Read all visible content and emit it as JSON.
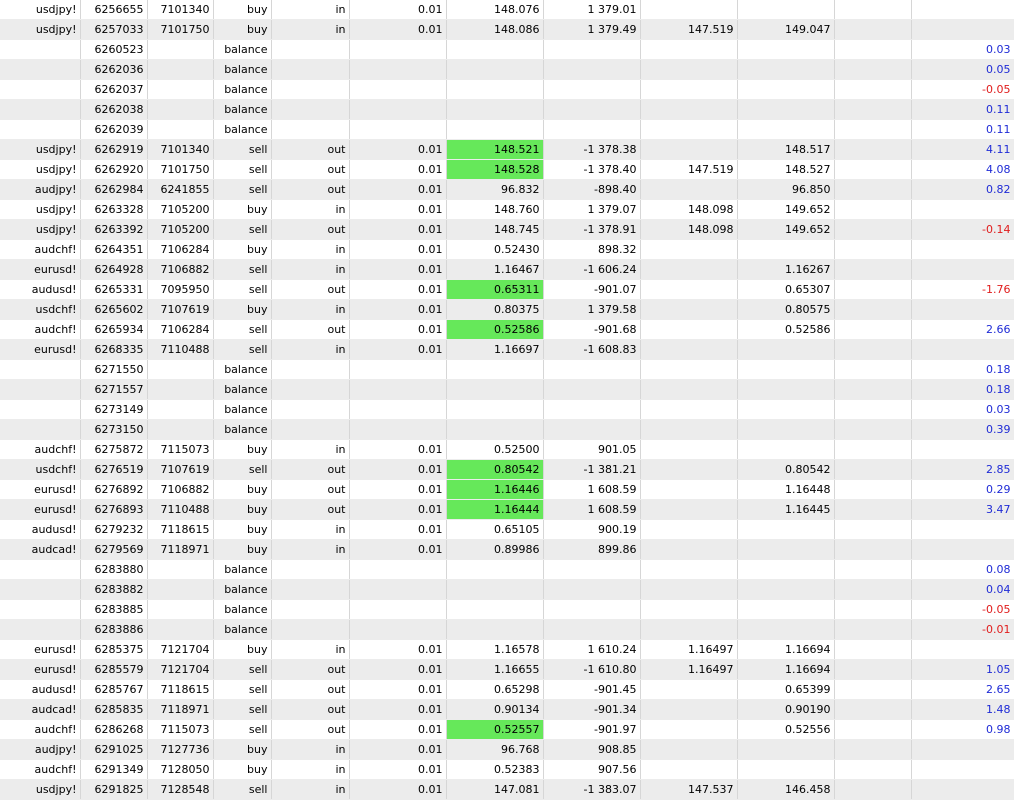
{
  "colors": {
    "highlight": "#66e85a",
    "profit_positive": "#1f2bd6",
    "profit_negative": "#e01c1c",
    "alt_row": "#ececec"
  },
  "rows": [
    {
      "symbol": "usdjpy!",
      "deal": "6256655",
      "order": "7101340",
      "type": "buy",
      "dir": "in",
      "volume": "0.01",
      "price": "148.076",
      "amount": "1 379.01",
      "sl": "",
      "tp": "",
      "profit": "",
      "hl": false
    },
    {
      "symbol": "usdjpy!",
      "deal": "6257033",
      "order": "7101750",
      "type": "buy",
      "dir": "in",
      "volume": "0.01",
      "price": "148.086",
      "amount": "1 379.49",
      "sl": "147.519",
      "tp": "149.047",
      "profit": "",
      "hl": false
    },
    {
      "symbol": "",
      "deal": "6260523",
      "order": "",
      "type": "balance",
      "dir": "",
      "volume": "",
      "price": "",
      "amount": "",
      "sl": "",
      "tp": "",
      "profit": "0.03",
      "hl": false
    },
    {
      "symbol": "",
      "deal": "6262036",
      "order": "",
      "type": "balance",
      "dir": "",
      "volume": "",
      "price": "",
      "amount": "",
      "sl": "",
      "tp": "",
      "profit": "0.05",
      "hl": false
    },
    {
      "symbol": "",
      "deal": "6262037",
      "order": "",
      "type": "balance",
      "dir": "",
      "volume": "",
      "price": "",
      "amount": "",
      "sl": "",
      "tp": "",
      "profit": "-0.05",
      "hl": false
    },
    {
      "symbol": "",
      "deal": "6262038",
      "order": "",
      "type": "balance",
      "dir": "",
      "volume": "",
      "price": "",
      "amount": "",
      "sl": "",
      "tp": "",
      "profit": "0.11",
      "hl": false
    },
    {
      "symbol": "",
      "deal": "6262039",
      "order": "",
      "type": "balance",
      "dir": "",
      "volume": "",
      "price": "",
      "amount": "",
      "sl": "",
      "tp": "",
      "profit": "0.11",
      "hl": false
    },
    {
      "symbol": "usdjpy!",
      "deal": "6262919",
      "order": "7101340",
      "type": "sell",
      "dir": "out",
      "volume": "0.01",
      "price": "148.521",
      "amount": "-1 378.38",
      "sl": "",
      "tp": "148.517",
      "profit": "4.11",
      "hl": true
    },
    {
      "symbol": "usdjpy!",
      "deal": "6262920",
      "order": "7101750",
      "type": "sell",
      "dir": "out",
      "volume": "0.01",
      "price": "148.528",
      "amount": "-1 378.40",
      "sl": "147.519",
      "tp": "148.527",
      "profit": "4.08",
      "hl": true
    },
    {
      "symbol": "audjpy!",
      "deal": "6262984",
      "order": "6241855",
      "type": "sell",
      "dir": "out",
      "volume": "0.01",
      "price": "96.832",
      "amount": "-898.40",
      "sl": "",
      "tp": "96.850",
      "profit": "0.82",
      "hl": false
    },
    {
      "symbol": "usdjpy!",
      "deal": "6263328",
      "order": "7105200",
      "type": "buy",
      "dir": "in",
      "volume": "0.01",
      "price": "148.760",
      "amount": "1 379.07",
      "sl": "148.098",
      "tp": "149.652",
      "profit": "",
      "hl": false
    },
    {
      "symbol": "usdjpy!",
      "deal": "6263392",
      "order": "7105200",
      "type": "sell",
      "dir": "out",
      "volume": "0.01",
      "price": "148.745",
      "amount": "-1 378.91",
      "sl": "148.098",
      "tp": "149.652",
      "profit": "-0.14",
      "hl": false
    },
    {
      "symbol": "audchf!",
      "deal": "6264351",
      "order": "7106284",
      "type": "buy",
      "dir": "in",
      "volume": "0.01",
      "price": "0.52430",
      "amount": "898.32",
      "sl": "",
      "tp": "",
      "profit": "",
      "hl": false
    },
    {
      "symbol": "eurusd!",
      "deal": "6264928",
      "order": "7106882",
      "type": "sell",
      "dir": "in",
      "volume": "0.01",
      "price": "1.16467",
      "amount": "-1 606.24",
      "sl": "",
      "tp": "1.16267",
      "profit": "",
      "hl": false
    },
    {
      "symbol": "audusd!",
      "deal": "6265331",
      "order": "7095950",
      "type": "sell",
      "dir": "out",
      "volume": "0.01",
      "price": "0.65311",
      "amount": "-901.07",
      "sl": "",
      "tp": "0.65307",
      "profit": "-1.76",
      "hl": true
    },
    {
      "symbol": "usdchf!",
      "deal": "6265602",
      "order": "7107619",
      "type": "buy",
      "dir": "in",
      "volume": "0.01",
      "price": "0.80375",
      "amount": "1 379.58",
      "sl": "",
      "tp": "0.80575",
      "profit": "",
      "hl": false
    },
    {
      "symbol": "audchf!",
      "deal": "6265934",
      "order": "7106284",
      "type": "sell",
      "dir": "out",
      "volume": "0.01",
      "price": "0.52586",
      "amount": "-901.68",
      "sl": "",
      "tp": "0.52586",
      "profit": "2.66",
      "hl": true
    },
    {
      "symbol": "eurusd!",
      "deal": "6268335",
      "order": "7110488",
      "type": "sell",
      "dir": "in",
      "volume": "0.01",
      "price": "1.16697",
      "amount": "-1 608.83",
      "sl": "",
      "tp": "",
      "profit": "",
      "hl": false
    },
    {
      "symbol": "",
      "deal": "6271550",
      "order": "",
      "type": "balance",
      "dir": "",
      "volume": "",
      "price": "",
      "amount": "",
      "sl": "",
      "tp": "",
      "profit": "0.18",
      "hl": false
    },
    {
      "symbol": "",
      "deal": "6271557",
      "order": "",
      "type": "balance",
      "dir": "",
      "volume": "",
      "price": "",
      "amount": "",
      "sl": "",
      "tp": "",
      "profit": "0.18",
      "hl": false
    },
    {
      "symbol": "",
      "deal": "6273149",
      "order": "",
      "type": "balance",
      "dir": "",
      "volume": "",
      "price": "",
      "amount": "",
      "sl": "",
      "tp": "",
      "profit": "0.03",
      "hl": false
    },
    {
      "symbol": "",
      "deal": "6273150",
      "order": "",
      "type": "balance",
      "dir": "",
      "volume": "",
      "price": "",
      "amount": "",
      "sl": "",
      "tp": "",
      "profit": "0.39",
      "hl": false
    },
    {
      "symbol": "audchf!",
      "deal": "6275872",
      "order": "7115073",
      "type": "buy",
      "dir": "in",
      "volume": "0.01",
      "price": "0.52500",
      "amount": "901.05",
      "sl": "",
      "tp": "",
      "profit": "",
      "hl": false
    },
    {
      "symbol": "usdchf!",
      "deal": "6276519",
      "order": "7107619",
      "type": "sell",
      "dir": "out",
      "volume": "0.01",
      "price": "0.80542",
      "amount": "-1 381.21",
      "sl": "",
      "tp": "0.80542",
      "profit": "2.85",
      "hl": true
    },
    {
      "symbol": "eurusd!",
      "deal": "6276892",
      "order": "7106882",
      "type": "buy",
      "dir": "out",
      "volume": "0.01",
      "price": "1.16446",
      "amount": "1 608.59",
      "sl": "",
      "tp": "1.16448",
      "profit": "0.29",
      "hl": true
    },
    {
      "symbol": "eurusd!",
      "deal": "6276893",
      "order": "7110488",
      "type": "buy",
      "dir": "out",
      "volume": "0.01",
      "price": "1.16444",
      "amount": "1 608.59",
      "sl": "",
      "tp": "1.16445",
      "profit": "3.47",
      "hl": true
    },
    {
      "symbol": "audusd!",
      "deal": "6279232",
      "order": "7118615",
      "type": "buy",
      "dir": "in",
      "volume": "0.01",
      "price": "0.65105",
      "amount": "900.19",
      "sl": "",
      "tp": "",
      "profit": "",
      "hl": false
    },
    {
      "symbol": "audcad!",
      "deal": "6279569",
      "order": "7118971",
      "type": "buy",
      "dir": "in",
      "volume": "0.01",
      "price": "0.89986",
      "amount": "899.86",
      "sl": "",
      "tp": "",
      "profit": "",
      "hl": false
    },
    {
      "symbol": "",
      "deal": "6283880",
      "order": "",
      "type": "balance",
      "dir": "",
      "volume": "",
      "price": "",
      "amount": "",
      "sl": "",
      "tp": "",
      "profit": "0.08",
      "hl": false
    },
    {
      "symbol": "",
      "deal": "6283882",
      "order": "",
      "type": "balance",
      "dir": "",
      "volume": "",
      "price": "",
      "amount": "",
      "sl": "",
      "tp": "",
      "profit": "0.04",
      "hl": false
    },
    {
      "symbol": "",
      "deal": "6283885",
      "order": "",
      "type": "balance",
      "dir": "",
      "volume": "",
      "price": "",
      "amount": "",
      "sl": "",
      "tp": "",
      "profit": "-0.05",
      "hl": false
    },
    {
      "symbol": "",
      "deal": "6283886",
      "order": "",
      "type": "balance",
      "dir": "",
      "volume": "",
      "price": "",
      "amount": "",
      "sl": "",
      "tp": "",
      "profit": "-0.01",
      "hl": false
    },
    {
      "symbol": "eurusd!",
      "deal": "6285375",
      "order": "7121704",
      "type": "buy",
      "dir": "in",
      "volume": "0.01",
      "price": "1.16578",
      "amount": "1 610.24",
      "sl": "1.16497",
      "tp": "1.16694",
      "profit": "",
      "hl": false
    },
    {
      "symbol": "eurusd!",
      "deal": "6285579",
      "order": "7121704",
      "type": "sell",
      "dir": "out",
      "volume": "0.01",
      "price": "1.16655",
      "amount": "-1 610.80",
      "sl": "1.16497",
      "tp": "1.16694",
      "profit": "1.05",
      "hl": false
    },
    {
      "symbol": "audusd!",
      "deal": "6285767",
      "order": "7118615",
      "type": "sell",
      "dir": "out",
      "volume": "0.01",
      "price": "0.65298",
      "amount": "-901.45",
      "sl": "",
      "tp": "0.65399",
      "profit": "2.65",
      "hl": false
    },
    {
      "symbol": "audcad!",
      "deal": "6285835",
      "order": "7118971",
      "type": "sell",
      "dir": "out",
      "volume": "0.01",
      "price": "0.90134",
      "amount": "-901.34",
      "sl": "",
      "tp": "0.90190",
      "profit": "1.48",
      "hl": false
    },
    {
      "symbol": "audchf!",
      "deal": "6286268",
      "order": "7115073",
      "type": "sell",
      "dir": "out",
      "volume": "0.01",
      "price": "0.52557",
      "amount": "-901.97",
      "sl": "",
      "tp": "0.52556",
      "profit": "0.98",
      "hl": true
    },
    {
      "symbol": "audjpy!",
      "deal": "6291025",
      "order": "7127736",
      "type": "buy",
      "dir": "in",
      "volume": "0.01",
      "price": "96.768",
      "amount": "908.85",
      "sl": "",
      "tp": "",
      "profit": "",
      "hl": false
    },
    {
      "symbol": "audchf!",
      "deal": "6291349",
      "order": "7128050",
      "type": "buy",
      "dir": "in",
      "volume": "0.01",
      "price": "0.52383",
      "amount": "907.56",
      "sl": "",
      "tp": "",
      "profit": "",
      "hl": false
    },
    {
      "symbol": "usdjpy!",
      "deal": "6291825",
      "order": "7128548",
      "type": "sell",
      "dir": "in",
      "volume": "0.01",
      "price": "147.081",
      "amount": "-1 383.07",
      "sl": "147.537",
      "tp": "146.458",
      "profit": "",
      "hl": false
    }
  ]
}
